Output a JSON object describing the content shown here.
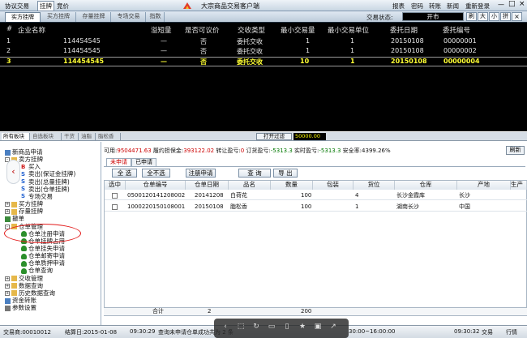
{
  "topmenu": {
    "items": [
      "协议交易",
      "挂牌",
      "竞价"
    ],
    "active": 1
  },
  "app_title": "大宗商品交易客户端",
  "top_right": [
    "报表",
    "密码",
    "转账",
    "新闻",
    "重新登录"
  ],
  "market_tabs": [
    "实方挂牌",
    "买方挂牌",
    "存量挂牌",
    "专场交易",
    "指数"
  ],
  "exchange_status_label": "交易状态:",
  "exchange_status_value": "开市",
  "tool_buttons": [
    "刷",
    "大",
    "小",
    "拼"
  ],
  "quote_headers": [
    "#",
    "企业名称",
    "溢短量",
    "是否可议价",
    "交收类型",
    "最小交易量",
    "最小交易单位",
    "委托日期",
    "委托编号"
  ],
  "quote_rows": [
    [
      "1",
      "114454545",
      "—",
      "否",
      "委托交收",
      "1",
      "1",
      "20150108",
      "00000001"
    ],
    [
      "2",
      "114454545",
      "—",
      "否",
      "委托交收",
      "1",
      "1",
      "20150108",
      "00000002"
    ],
    [
      "3",
      "114454545",
      "—",
      "否",
      "委托交收",
      "10",
      "1",
      "20150108",
      "00000004"
    ]
  ],
  "mid_tabs": [
    "所有板块",
    "自选板块",
    "干货",
    "油脂",
    "脂松香"
  ],
  "filter_label": "打开过滤",
  "filter_time": "50000.00",
  "tree": [
    {
      "label": "新商品申请",
      "level": 0,
      "icon": "doc"
    },
    {
      "label": "卖方挂牌",
      "level": 0,
      "icon": "folder",
      "exp": "-"
    },
    {
      "label": "买入",
      "level": 1,
      "icon": "b"
    },
    {
      "label": "卖出(保证金挂牌)",
      "level": 1,
      "icon": "s"
    },
    {
      "label": "卖出(总量挂牌)",
      "level": 1,
      "icon": "s"
    },
    {
      "label": "卖出(仓单挂牌)",
      "level": 1,
      "icon": "s"
    },
    {
      "label": "专场交易",
      "level": 1,
      "icon": "s"
    },
    {
      "label": "买方挂牌",
      "level": 0,
      "icon": "folder",
      "exp": "+"
    },
    {
      "label": "存量挂牌",
      "level": 0,
      "icon": "folder",
      "exp": "+"
    },
    {
      "label": "撤单",
      "level": 0,
      "icon": "undo"
    },
    {
      "label": "仓单管理",
      "level": 0,
      "icon": "folder",
      "exp": "-"
    },
    {
      "label": "仓单注册申请",
      "level": 1,
      "icon": "person"
    },
    {
      "label": "仓单挂牌占用",
      "level": 1,
      "icon": "person"
    },
    {
      "label": "仓单挂失申请",
      "level": 1,
      "icon": "person"
    },
    {
      "label": "仓单邮寄申请",
      "level": 1,
      "icon": "person"
    },
    {
      "label": "仓单质押申请",
      "level": 1,
      "icon": "person"
    },
    {
      "label": "仓单查询",
      "level": 1,
      "icon": "person"
    },
    {
      "label": "交收管理",
      "level": 0,
      "icon": "folder",
      "exp": "+"
    },
    {
      "label": "数据查询",
      "level": 0,
      "icon": "folder",
      "exp": "+"
    },
    {
      "label": "历史数据查询",
      "level": 0,
      "icon": "folder",
      "exp": "+"
    },
    {
      "label": "资金转账",
      "level": 0,
      "icon": "doc"
    },
    {
      "label": "参数设置",
      "level": 0,
      "icon": "gear"
    }
  ],
  "fund": {
    "l1": "可用:",
    "v1": "9504471.63",
    "l2": "履约担保金:",
    "v2": "393122.02",
    "l3": "转让盈亏:",
    "v3": "0",
    "l4": "订货盈亏:",
    "v4": "-5313.3",
    "l5": "实时盈亏:",
    "v5": "-5313.3",
    "l6": "安全率:",
    "v6": "4399.26%"
  },
  "refresh_label": "刷新",
  "content_tabs": [
    "未申请",
    "已申请"
  ],
  "action_buttons": [
    "全 选",
    "全不选",
    "注册申请",
    "查 询",
    "导 出"
  ],
  "grid_headers": [
    "选中",
    "仓单编号",
    "仓单日期",
    "品名",
    "数量",
    "包装",
    "货位",
    "仓库",
    "产地",
    "生产"
  ],
  "grid_rows": [
    [
      "",
      "0500120141208002",
      "20141208",
      "白荷花",
      "100",
      "",
      "4",
      "长沙金霞库",
      "长沙",
      ""
    ],
    [
      "",
      "1000220150108001",
      "20150108",
      "脂松香",
      "100",
      "",
      "1",
      "湖南长沙",
      "中国",
      ""
    ]
  ],
  "sum": {
    "label": "合计",
    "count": "2",
    "qty": "200"
  },
  "statusbar": {
    "node": "交易商:00010012",
    "date": "结算日:2015-01-08",
    "time": "09:30:29",
    "msg": "查询未申请仓单成功共为 2 条",
    "range": "30:00~16:00:00",
    "right_time": "09:30:32",
    "right1": "交易",
    "right2": "行情"
  },
  "overlay_icons": [
    "prev-icon",
    "crop-icon",
    "rotate-icon",
    "fit-icon",
    "save-icon",
    "star-icon",
    "grid-icon",
    "share-icon"
  ]
}
